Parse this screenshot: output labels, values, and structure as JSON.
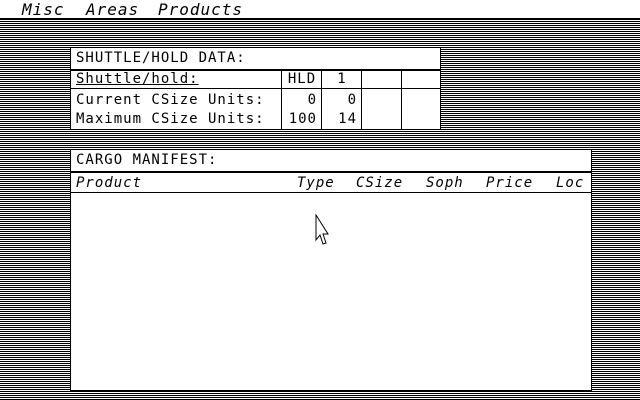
{
  "menubar": {
    "items": [
      {
        "label": "Misc"
      },
      {
        "label": "Areas"
      },
      {
        "label": "Products"
      }
    ]
  },
  "shuttle_hold": {
    "title": "SHUTTLE/HOLD DATA:",
    "row_labels": [
      "Shuttle/hold:",
      "Current CSize Units:",
      "Maximum CSize Units:"
    ],
    "columns": [
      {
        "header": "HLD",
        "current": "0",
        "maximum": "100"
      },
      {
        "header": "1",
        "current": "0",
        "maximum": "14"
      },
      {
        "header": "",
        "current": "",
        "maximum": ""
      },
      {
        "header": "",
        "current": "",
        "maximum": ""
      }
    ]
  },
  "cargo_manifest": {
    "title": "CARGO MANIFEST:",
    "headers": [
      "Product",
      "Type",
      "CSize",
      "Soph",
      "Price",
      "Loc"
    ],
    "rows": []
  },
  "pointer": {
    "icon": "arrow-pointer-icon"
  }
}
